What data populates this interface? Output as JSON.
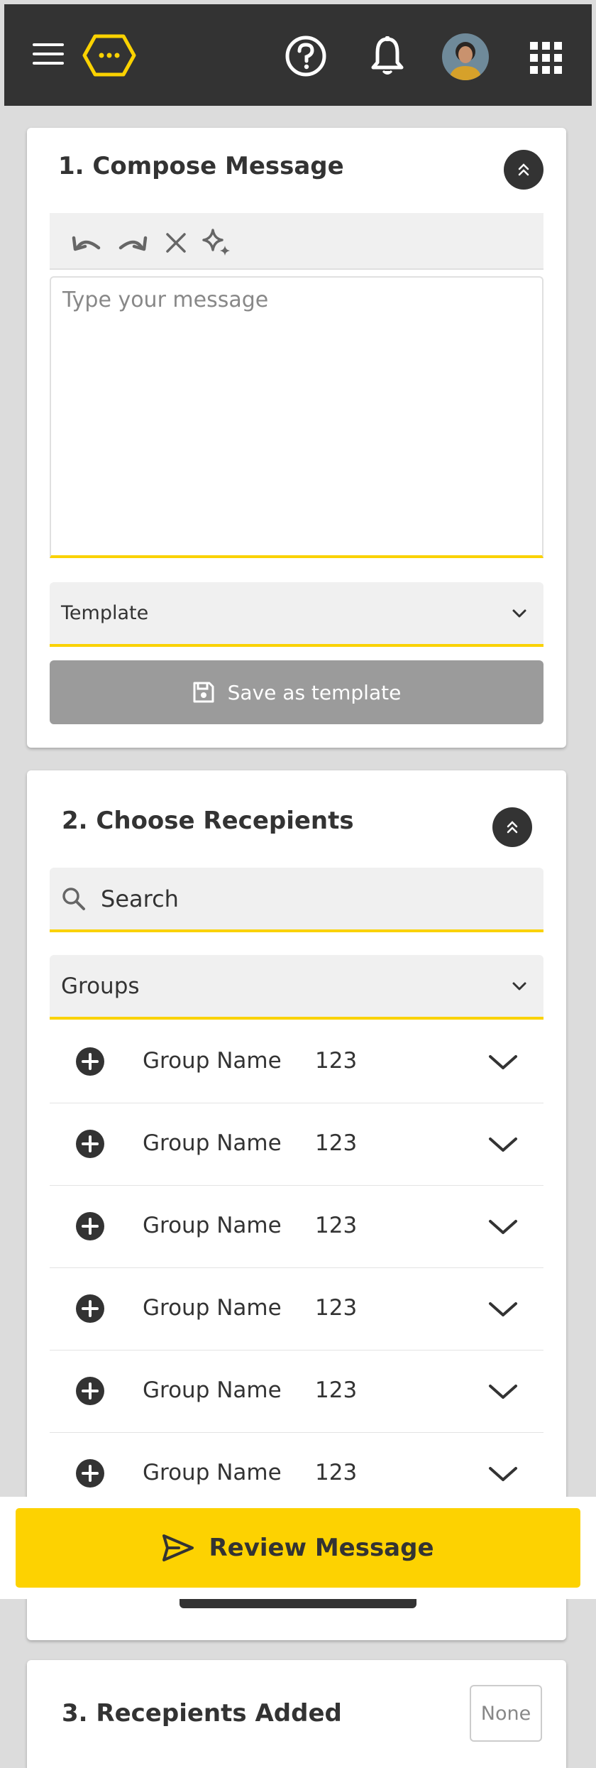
{
  "header": {
    "icons": [
      "menu-icon",
      "logo-icon",
      "help-icon",
      "bell-icon",
      "avatar",
      "apps-icon"
    ]
  },
  "compose": {
    "title": "1. Compose Message",
    "toolbar_icons": [
      "undo-icon",
      "redo-icon",
      "clear-icon",
      "sparkle-icon"
    ],
    "message_placeholder": "Type your message",
    "message_value": "",
    "template_label": "Template",
    "save_template_label": "Save as template"
  },
  "recipients": {
    "title": "2. Choose Recepients",
    "search_placeholder": "Search",
    "groups_label": "Groups",
    "groups": [
      {
        "name": "Group Name",
        "count": "123"
      },
      {
        "name": "Group Name",
        "count": "123"
      },
      {
        "name": "Group Name",
        "count": "123"
      },
      {
        "name": "Group Name",
        "count": "123"
      },
      {
        "name": "Group Name",
        "count": "123"
      },
      {
        "name": "Group Name",
        "count": "123"
      }
    ]
  },
  "review": {
    "label": "Review Message"
  },
  "added": {
    "title": "3. Recepients Added",
    "badge": "None"
  },
  "colors": {
    "accent": "#fad201",
    "dark": "#333333",
    "disabled": "#9b9b9b"
  }
}
